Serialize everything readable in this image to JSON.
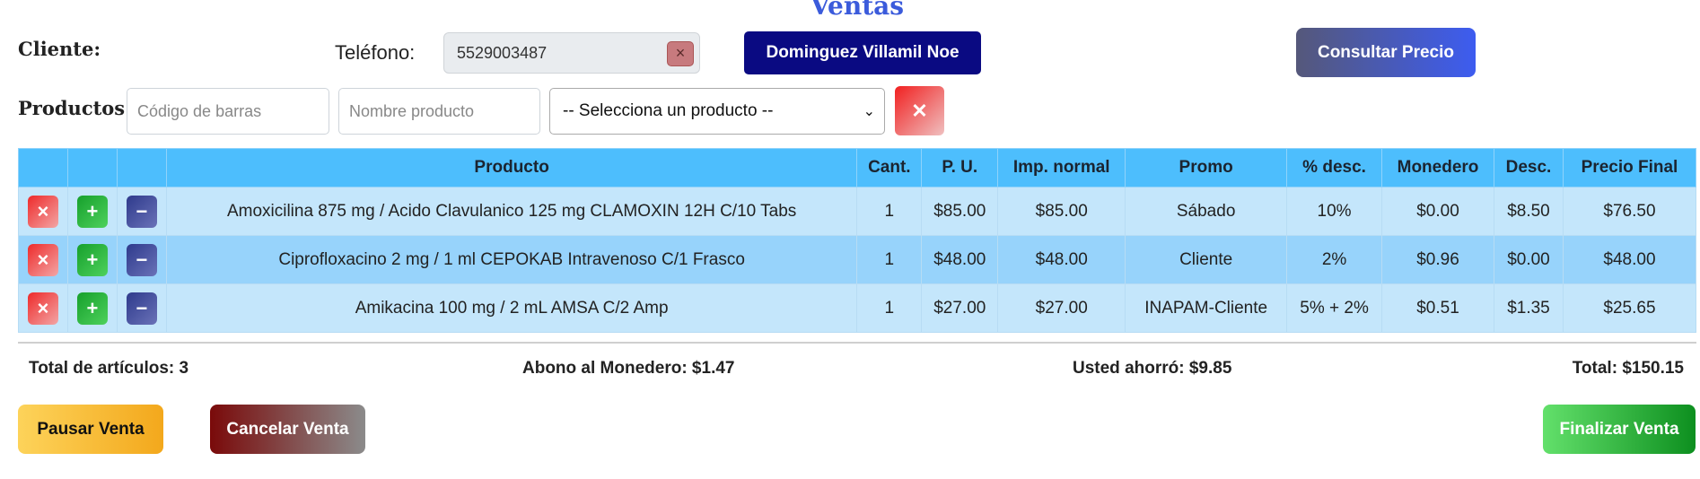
{
  "page": {
    "title": "Ventas"
  },
  "cliente": {
    "label": "Cliente:",
    "telefono_label": "Teléfono:",
    "telefono_value": "5529003487",
    "clear_symbol": "×",
    "nombre_button": "Dominguez Villamil Noe",
    "consultar_button": "Consultar Precio"
  },
  "productos": {
    "label": "Productos:",
    "codigo_placeholder": "Código de barras",
    "nombre_placeholder": "Nombre producto",
    "select_value": "-- Selecciona un producto --",
    "select_chevron": "⌄",
    "clear_symbol": "✕"
  },
  "table": {
    "headers": [
      "",
      "",
      "",
      "Producto",
      "Cant.",
      "P. U.",
      "Imp. normal",
      "Promo",
      "% desc.",
      "Monedero",
      "Desc.",
      "Precio Final"
    ],
    "action_symbols": {
      "delete": "×",
      "plus": "+",
      "minus": "−"
    },
    "rows": [
      {
        "producto": "Amoxicilina 875 mg / Acido Clavulanico 125 mg CLAMOXIN 12H C/10 Tabs",
        "cant": "1",
        "pu": "$85.00",
        "imp": "$85.00",
        "promo": "Sábado",
        "pdesc": "10%",
        "monedero": "$0.00",
        "desc": "$8.50",
        "final": "$76.50"
      },
      {
        "producto": "Ciprofloxacino 2 mg / 1 ml CEPOKAB Intravenoso C/1 Frasco",
        "cant": "1",
        "pu": "$48.00",
        "imp": "$48.00",
        "promo": "Cliente",
        "pdesc": "2%",
        "monedero": "$0.96",
        "desc": "$0.00",
        "final": "$48.00"
      },
      {
        "producto": "Amikacina 100 mg / 2 mL AMSA C/2 Amp",
        "cant": "1",
        "pu": "$27.00",
        "imp": "$27.00",
        "promo": "INAPAM-Cliente",
        "pdesc": "5% + 2%",
        "monedero": "$0.51",
        "desc": "$1.35",
        "final": "$25.65"
      }
    ]
  },
  "totals": {
    "articulos": "Total de artículos: 3",
    "abono": "Abono al Monedero: $1.47",
    "ahorro": "Usted ahorró: $9.85",
    "total": "Total: $150.15"
  },
  "footer": {
    "pausar": "Pausar Venta",
    "cancelar": "Cancelar Venta",
    "finalizar": "Finalizar Venta"
  }
}
